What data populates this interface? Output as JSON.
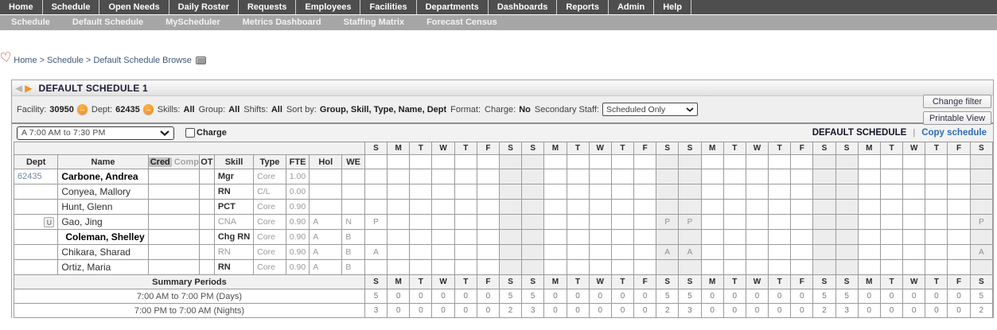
{
  "nav": {
    "items": [
      "Home",
      "Schedule",
      "Open Needs",
      "Daily Roster",
      "Requests",
      "Employees",
      "Facilities",
      "Departments",
      "Dashboards",
      "Reports",
      "Admin",
      "Help"
    ]
  },
  "subnav": {
    "items": [
      "Schedule",
      "Default Schedule",
      "MyScheduler",
      "Metrics Dashboard",
      "Staffing Matrix",
      "Forecast Census"
    ]
  },
  "breadcrumb": {
    "items": [
      "Home",
      "Schedule",
      "Default Schedule Browse"
    ],
    "separator": ">"
  },
  "panel": {
    "title": "DEFAULT SCHEDULE 1",
    "filter": {
      "segments": [
        {
          "label": "Facility:",
          "value": "30950",
          "icon": true
        },
        {
          "label": "Dept:",
          "value": "62435",
          "icon": true
        },
        {
          "label": "Skills:",
          "value": "All"
        },
        {
          "label": "Group:",
          "value": "All"
        },
        {
          "label": "Shifts:",
          "value": "All"
        },
        {
          "label": "Sort by:",
          "value": "Group, Skill, Type, Name, Dept"
        },
        {
          "label": "Format:",
          "value": ""
        },
        {
          "label": "Charge:",
          "value": "No"
        }
      ],
      "secondary_staff_label": "Secondary Staff:",
      "secondary_staff_value": "Scheduled Only"
    },
    "change_filter_label": "Change filter",
    "printable_view_label": "Printable View",
    "shift_select_value": "A  7:00 AM to 7:30 PM",
    "charge_label": "Charge",
    "charge_checked": false,
    "schedule_name_label": "DEFAULT SCHEDULE",
    "separator": "|",
    "copy_schedule_label": "Copy schedule"
  },
  "grid": {
    "headers": {
      "dept": "Dept",
      "name": "Name",
      "cred": "Cred",
      "comp": "Comp",
      "ot": "OT",
      "skill": "Skill",
      "type": "Type",
      "fte": "FTE",
      "hol": "Hol",
      "we": "WE"
    },
    "day_letters": [
      "S",
      "M",
      "T",
      "W",
      "T",
      "F",
      "S",
      "S",
      "M",
      "T",
      "W",
      "T",
      "F",
      "S",
      "S",
      "M",
      "T",
      "W",
      "T",
      "F",
      "S",
      "S",
      "M",
      "T",
      "W",
      "T",
      "F",
      "S"
    ],
    "weekend_cols": [
      6,
      7,
      13,
      14,
      20,
      21,
      27
    ],
    "employees": [
      {
        "dept": "62435",
        "name": "Carbone, Andrea",
        "name_bold": true,
        "skill": "Mgr",
        "skill_bold": true,
        "type": "Core",
        "fte": "1.00",
        "hol": "",
        "we": "",
        "marks": {}
      },
      {
        "name": "Conyea, Mallory",
        "skill": "RN",
        "skill_bold": true,
        "type": "C/L",
        "fte": "0.00",
        "hol": "",
        "we": "",
        "marks": {}
      },
      {
        "name": "Hunt, Glenn",
        "skill": "PCT",
        "skill_bold": true,
        "type": "Core",
        "fte": "0.90",
        "hol": "",
        "we": "",
        "marks": {}
      },
      {
        "u_badge": "U",
        "name": "Gao, Jing",
        "skill": "CNA",
        "type": "Core",
        "fte": "0.90",
        "hol": "A",
        "we": "N",
        "marks": {
          "0": "P",
          "13": "P",
          "14": "P",
          "27": "P"
        }
      },
      {
        "name": "Coleman, Shelley",
        "name_bold": true,
        "indent": true,
        "skill": "Chg RN",
        "skill_bold": true,
        "type": "Core",
        "fte": "0.90",
        "hol": "A",
        "we": "B",
        "marks": {}
      },
      {
        "name": "Chikara, Sharad",
        "skill": "RN",
        "type": "Core",
        "fte": "0.90",
        "hol": "A",
        "we": "B",
        "marks": {
          "0": "A",
          "13": "A",
          "14": "A",
          "27": "A"
        }
      },
      {
        "name": "Ortiz, Maria",
        "skill": "RN",
        "skill_bold": true,
        "type": "Core",
        "fte": "0.90",
        "hol": "A",
        "we": "B",
        "marks": {}
      }
    ],
    "summary": {
      "header": "Summary Periods",
      "rows": [
        {
          "label": "7:00 AM to 7:00 PM (Days)",
          "values": [
            5,
            0,
            0,
            0,
            0,
            0,
            5,
            5,
            0,
            0,
            0,
            0,
            0,
            5,
            5,
            0,
            0,
            0,
            0,
            0,
            5,
            5,
            0,
            0,
            0,
            0,
            0,
            5
          ]
        },
        {
          "label": "7:00 PM to 7:00 AM (Nights)",
          "values": [
            3,
            0,
            0,
            0,
            0,
            0,
            2,
            3,
            0,
            0,
            0,
            0,
            0,
            2,
            3,
            0,
            0,
            0,
            0,
            0,
            2,
            3,
            0,
            0,
            0,
            0,
            0,
            2
          ]
        }
      ]
    }
  },
  "colors": {
    "accent_orange": "#f29422",
    "link_blue": "#2e6db5",
    "nav_dark": "#4e4e4e",
    "nav_light": "#a6a6a6"
  }
}
